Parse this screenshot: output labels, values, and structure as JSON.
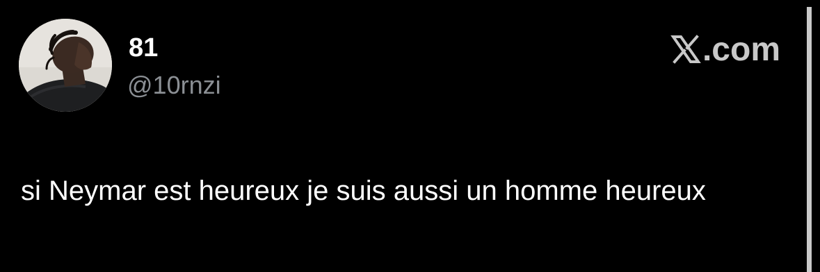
{
  "tweet": {
    "display_name": "81",
    "handle": "@10rnzi",
    "text": "si Neymar est heureux je suis aussi un homme heureux"
  },
  "brand": {
    "icon": "x-logo-icon",
    "suffix": ".com"
  },
  "colors": {
    "background": "#000000",
    "text": "#ffffff",
    "handle": "#8b8f94",
    "brand": "#c8c8c8"
  }
}
